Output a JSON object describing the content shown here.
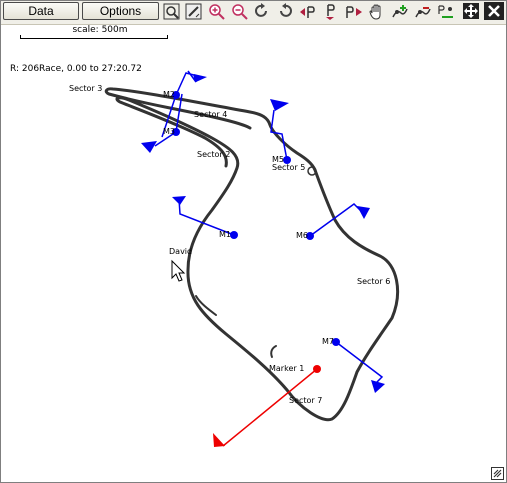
{
  "toolbar": {
    "data_label": "Data",
    "options_label": "Options",
    "icons": [
      "zoom-fit-icon",
      "zoom-region-icon",
      "zoom-in-icon",
      "zoom-out-icon",
      "rotate-cw-icon",
      "rotate-ccw-icon",
      "prev-marker-icon",
      "goto-marker-icon",
      "next-marker-icon",
      "pan-hand-icon",
      "add-marker-icon",
      "remove-marker-icon",
      "range-marker-icon",
      "move-icon",
      "close-icon"
    ]
  },
  "scale": {
    "label": "scale: 500m"
  },
  "info": {
    "text": "R: 206Race, 0.00 to 27:20.72"
  },
  "map": {
    "track_color": "#333333",
    "marker_color": "#0000ee",
    "active_marker_color": "#ee0000",
    "sector_labels": [
      "Sector 3",
      "Sector 4",
      "Sector 2",
      "Sector 5",
      "Sector 6",
      "Sector 7"
    ],
    "marker_labels": [
      "M2",
      "M3",
      "M5",
      "M1",
      "M6",
      "M7",
      "Marker 1"
    ],
    "place_label": "David"
  }
}
